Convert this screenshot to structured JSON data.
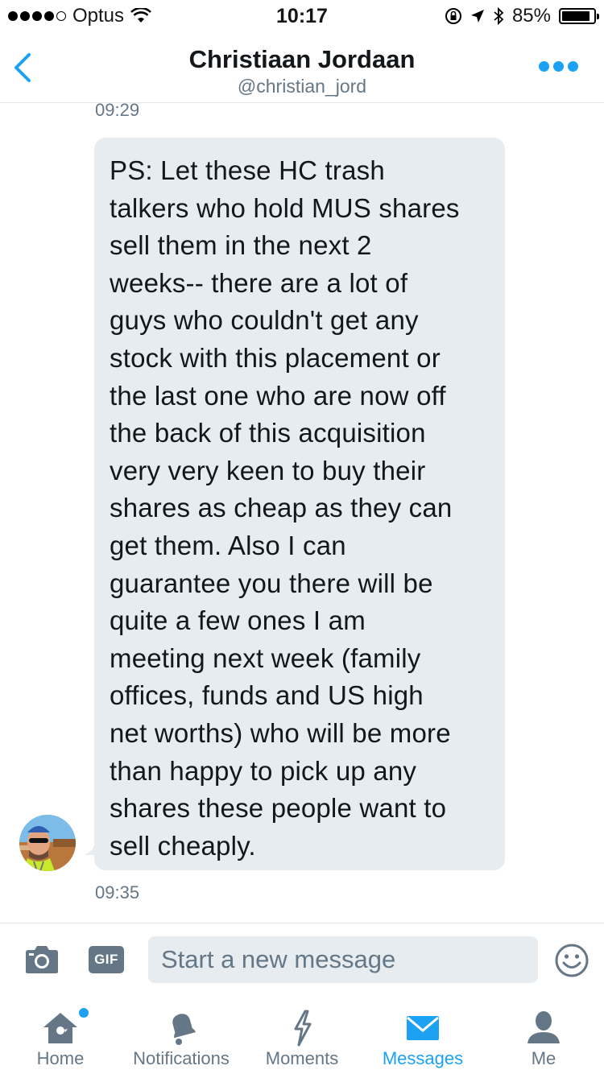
{
  "status": {
    "carrier": "Optus",
    "time": "10:17",
    "battery": "85%"
  },
  "header": {
    "name": "Christiaan Jordaan",
    "handle": "@christian_jord"
  },
  "conversation": {
    "top_timestamp": "09:29",
    "message": {
      "lines": [
        "PS: Let these HC trash",
        "talkers who hold MUS shares",
        "sell them in the next 2",
        "weeks-- there are a lot of",
        "guys who couldn't get any",
        "stock with this placement or",
        "the last one who are now off",
        "the back of this acquisition",
        "very very keen to buy their",
        "shares as cheap as they can",
        "get them. Also I can",
        "guarantee you there will be",
        "quite a few ones I am",
        "meeting next week (family",
        "offices, funds and US high",
        "net worths) who will be more",
        "than happy to pick up any",
        "shares these people want to",
        "sell cheaply."
      ],
      "timestamp": "09:35"
    }
  },
  "compose": {
    "gif_label": "GIF",
    "placeholder": "Start a new message"
  },
  "tabs": {
    "home": "Home",
    "notifications": "Notifications",
    "moments": "Moments",
    "messages": "Messages",
    "me": "Me"
  },
  "colors": {
    "accent": "#1da1f2",
    "secondary_text": "#657786",
    "bubble_bg": "#e6ecf0"
  }
}
